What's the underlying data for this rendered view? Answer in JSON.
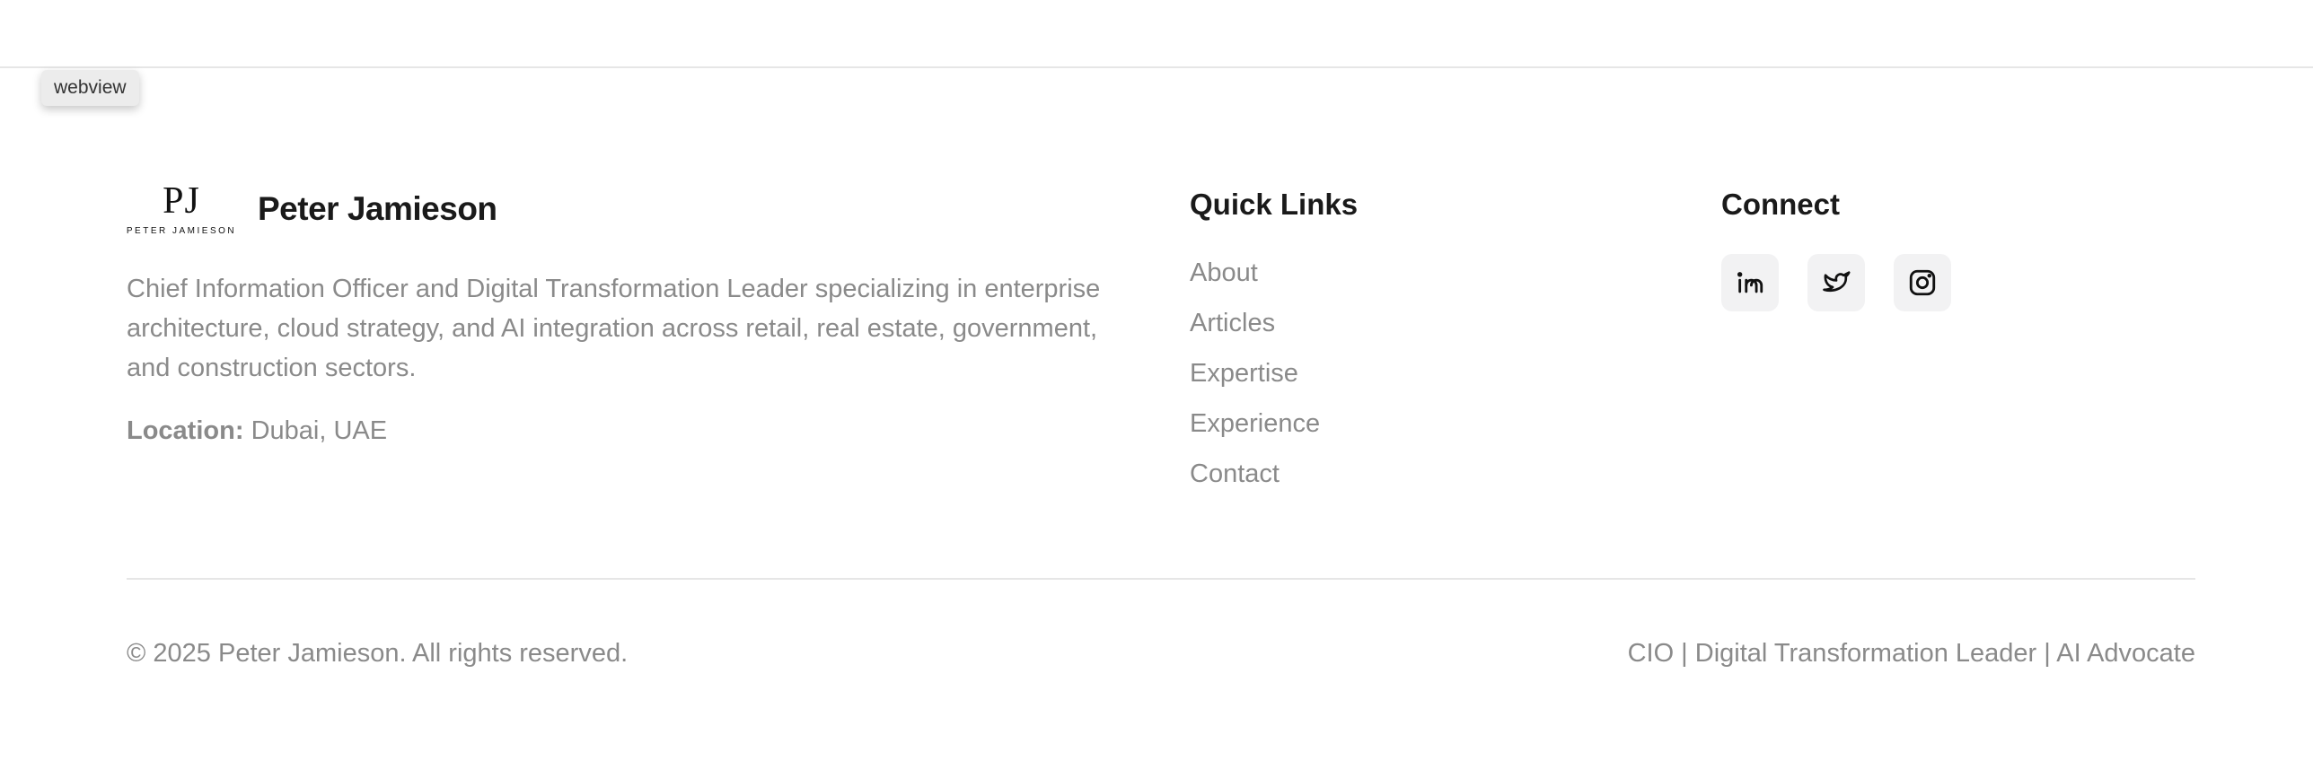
{
  "webview_badge": "webview",
  "brand": {
    "logo_monogram": "PJ",
    "logo_subtitle": "PETER JAMIESON",
    "name": "Peter Jamieson"
  },
  "bio": "Chief Information Officer and Digital Transformation Leader specializing in enterprise architecture, cloud strategy, and AI integration across retail, real estate, government, and construction sectors.",
  "location": {
    "label": "Location:",
    "value": "Dubai, UAE"
  },
  "quick_links": {
    "title": "Quick Links",
    "items": [
      "About",
      "Articles",
      "Expertise",
      "Experience",
      "Contact"
    ]
  },
  "connect": {
    "title": "Connect",
    "icons": [
      "linkedin-icon",
      "twitter-icon",
      "instagram-icon"
    ]
  },
  "footer": {
    "copyright": "© 2025 Peter Jamieson. All rights reserved.",
    "tagline": "CIO | Digital Transformation Leader | AI Advocate"
  },
  "colors": {
    "text_dark": "#1a1a1a",
    "text_muted": "#8a8a8a",
    "divider": "#e6e6e6",
    "icon_bg": "#f2f2f3"
  }
}
